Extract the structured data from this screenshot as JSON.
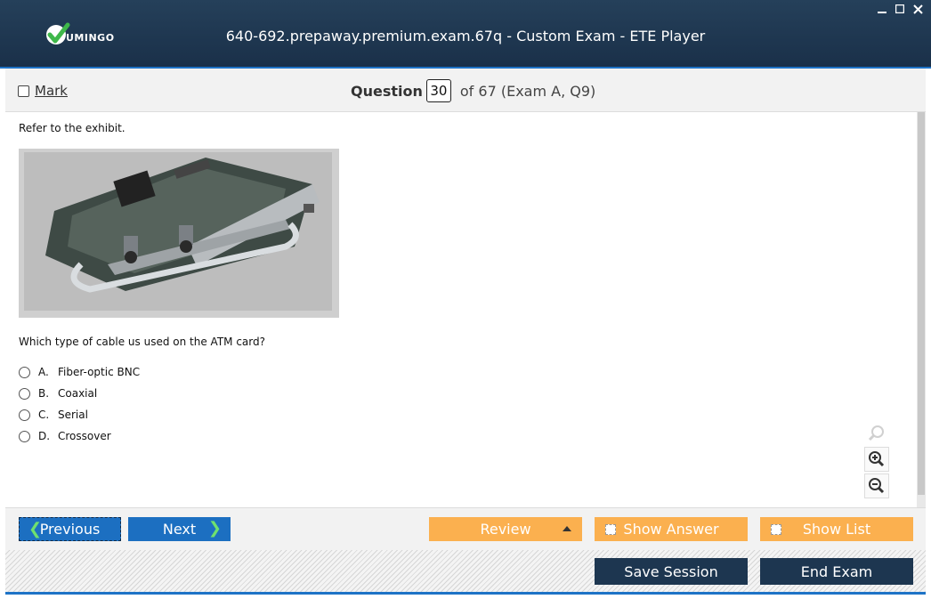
{
  "window": {
    "title": "640-692.prepaway.premium.exam.67q - Custom Exam - ETE Player",
    "logo_text": "UMINGO",
    "controls": [
      "minimize",
      "maximize",
      "close"
    ]
  },
  "question_bar": {
    "mark_label": "Mark",
    "question_word": "Question",
    "current_number": "30",
    "of_text": "of 67 (Exam A, Q9)"
  },
  "content": {
    "prompt": "Refer to the exhibit.",
    "question": "Which type of cable us used on the ATM card?",
    "answers": [
      {
        "letter": "A.",
        "text": "Fiber-optic BNC"
      },
      {
        "letter": "B.",
        "text": "Coaxial"
      },
      {
        "letter": "C.",
        "text": "Serial"
      },
      {
        "letter": "D.",
        "text": "Crossover"
      }
    ]
  },
  "buttons": {
    "previous": "Previous",
    "next": "Next",
    "review": "Review",
    "show_answer": "Show Answer",
    "show_list": "Show List",
    "save_session": "Save Session",
    "end_exam": "End Exam"
  },
  "colors": {
    "title_bg": "#1e3550",
    "accent_blue": "#1c6fc1",
    "orange": "#fbb04f",
    "dark_button": "#1d3650"
  }
}
